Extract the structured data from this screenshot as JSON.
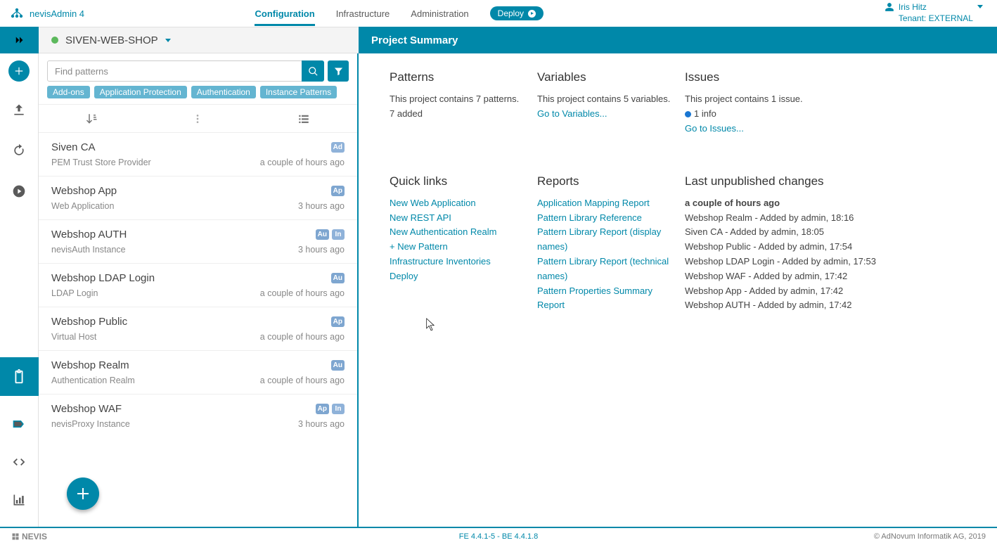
{
  "brand": "nevisAdmin 4",
  "topnav": {
    "configuration": "Configuration",
    "infrastructure": "Infrastructure",
    "administration": "Administration"
  },
  "deploy_label": "Deploy",
  "user": {
    "name": "Iris Hitz",
    "tenant": "Tenant: EXTERNAL"
  },
  "project_name": "SIVEN-WEB-SHOP",
  "page_title": "Project Summary",
  "search": {
    "placeholder": "Find patterns"
  },
  "chips": [
    "Add-ons",
    "Application Protection",
    "Authentication",
    "Instance Patterns"
  ],
  "patterns": [
    {
      "name": "Siven CA",
      "type": "PEM Trust Store Provider",
      "time": "a couple of hours ago",
      "badges": [
        "Ad"
      ]
    },
    {
      "name": "Webshop App",
      "type": "Web Application",
      "time": "3 hours ago",
      "badges": [
        "Ap"
      ]
    },
    {
      "name": "Webshop AUTH",
      "type": "nevisAuth Instance",
      "time": "3 hours ago",
      "badges": [
        "Au",
        "In"
      ]
    },
    {
      "name": "Webshop LDAP Login",
      "type": "LDAP Login",
      "time": "a couple of hours ago",
      "badges": [
        "Au"
      ]
    },
    {
      "name": "Webshop Public",
      "type": "Virtual Host",
      "time": "a couple of hours ago",
      "badges": [
        "Ap"
      ]
    },
    {
      "name": "Webshop Realm",
      "type": "Authentication Realm",
      "time": "a couple of hours ago",
      "badges": [
        "Au"
      ]
    },
    {
      "name": "Webshop WAF",
      "type": "nevisProxy Instance",
      "time": "3 hours ago",
      "badges": [
        "Ap",
        "In"
      ]
    }
  ],
  "summary": {
    "patterns": {
      "title": "Patterns",
      "line1": "This project contains 7 patterns.",
      "line2": "7 added"
    },
    "variables": {
      "title": "Variables",
      "line1": "This project contains 5 variables.",
      "link": "Go to Variables..."
    },
    "issues": {
      "title": "Issues",
      "line1": "This project contains 1 issue.",
      "info": "1 info",
      "link": "Go to Issues..."
    },
    "quicklinks": {
      "title": "Quick links",
      "items": [
        "New Web Application",
        "New REST API",
        "New Authentication Realm",
        "+ New Pattern",
        "Infrastructure Inventories",
        "Deploy"
      ]
    },
    "reports": {
      "title": "Reports",
      "items": [
        "Application Mapping Report",
        "Pattern Library Reference",
        "Pattern Library Report (display names)",
        "Pattern Library Report (technical names)",
        "Pattern Properties Summary Report"
      ]
    },
    "changes": {
      "title": "Last unpublished changes",
      "when": "a couple of hours ago",
      "items": [
        "Webshop Realm - Added by admin, 18:16",
        "Siven CA - Added by admin, 18:05",
        "Webshop Public - Added by admin, 17:54",
        "Webshop LDAP Login - Added by admin, 17:53",
        "Webshop WAF - Added by admin, 17:42",
        "Webshop App - Added by admin, 17:42",
        "Webshop AUTH - Added by admin, 17:42"
      ]
    }
  },
  "footer": {
    "logo": "NEVIS",
    "version": "FE 4.4.1-5 - BE 4.4.1.8",
    "copyright": "© AdNovum Informatik AG, 2019"
  }
}
